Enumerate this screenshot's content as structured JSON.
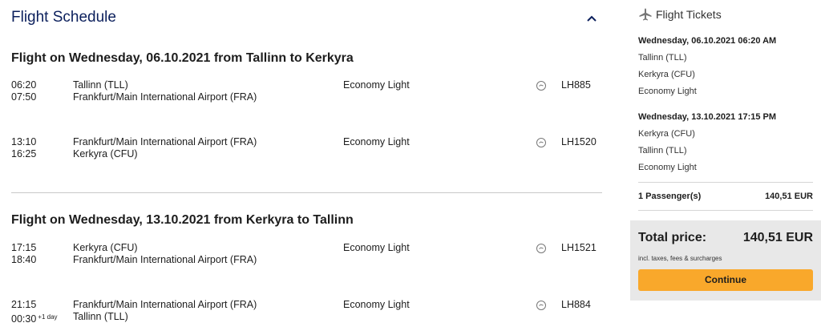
{
  "schedule": {
    "title": "Flight Schedule"
  },
  "outbound": {
    "title": "Flight on Wednesday, 06.10.2021 from Tallinn to Kerkyra",
    "segments": [
      {
        "dep_time": "06:20",
        "arr_time": "07:50",
        "arr_extra": "",
        "from": "Tallinn (TLL)",
        "to": "Frankfurt/Main International Airport (FRA)",
        "fare": "Economy Light",
        "flight_no": "LH885"
      },
      {
        "dep_time": "13:10",
        "arr_time": "16:25",
        "arr_extra": "",
        "from": "Frankfurt/Main International Airport (FRA)",
        "to": "Kerkyra (CFU)",
        "fare": "Economy Light",
        "flight_no": "LH1520"
      }
    ]
  },
  "inbound": {
    "title": "Flight on Wednesday, 13.10.2021 from Kerkyra to Tallinn",
    "segments": [
      {
        "dep_time": "17:15",
        "arr_time": "18:40",
        "arr_extra": "",
        "from": "Kerkyra (CFU)",
        "to": "Frankfurt/Main International Airport (FRA)",
        "fare": "Economy Light",
        "flight_no": "LH1521"
      },
      {
        "dep_time": "21:15",
        "arr_time": "00:30",
        "arr_extra": "+1 day",
        "from": "Frankfurt/Main International Airport (FRA)",
        "to": "Tallinn (TLL)",
        "fare": "Economy Light",
        "flight_no": "LH884"
      }
    ]
  },
  "tickets": {
    "title": "Flight Tickets",
    "trips": [
      {
        "date": "Wednesday, 06.10.2021 06:20 AM",
        "from": "Tallinn (TLL)",
        "to": "Kerkyra (CFU)",
        "fare": "Economy Light"
      },
      {
        "date": "Wednesday, 13.10.2021 17:15 PM",
        "from": "Kerkyra (CFU)",
        "to": "Tallinn (TLL)",
        "fare": "Economy Light"
      }
    ],
    "passengers_label": "1 Passenger(s)",
    "passengers_price": "140,51 EUR",
    "total_label": "Total price:",
    "total_value": "140,51 EUR",
    "total_note": "incl. taxes, fees & surcharges",
    "continue_label": "Continue"
  },
  "colors": {
    "title_blue": "#0b1f5c",
    "continue_orange": "#f9a82b",
    "total_bg": "#e8e8e8"
  },
  "icons": {
    "collapse": "chevron-up-icon",
    "tickets": "airplane-icon",
    "segment_info": "info-circle-icon"
  }
}
